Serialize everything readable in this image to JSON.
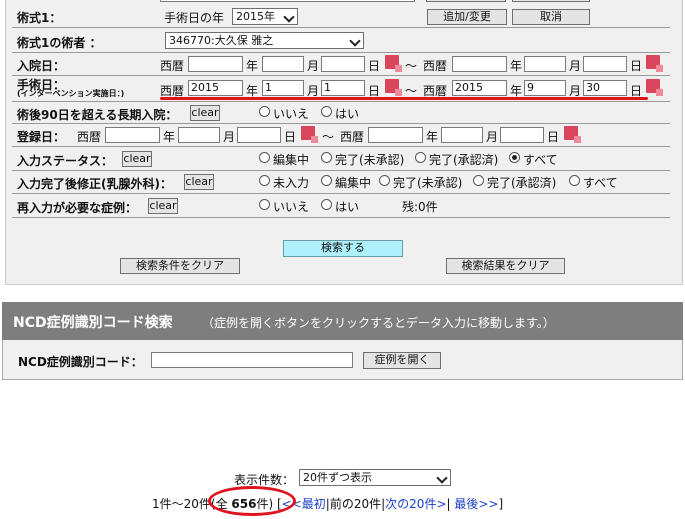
{
  "search_form": {
    "procedure1": {
      "label": "術式1：",
      "year_label": "手術日の年",
      "year_value": "2015年",
      "add_button": "追加/変更",
      "cancel_button": "取消"
    },
    "surgeon": {
      "label": "術式1の術者 ：",
      "value": "346770:大久保 雅之"
    },
    "admission": {
      "label": "入院日：",
      "era": "西暦",
      "year": "年",
      "month": "月",
      "day": "日",
      "tilde": "～",
      "era2": "西暦",
      "year2": "年",
      "month2": "月",
      "day2": "日"
    },
    "surgery_date": {
      "label": "手術日：",
      "sublabel": "(インターベンション実施日：)",
      "era": "西暦",
      "from_year": "2015",
      "year": "年",
      "from_month": "1",
      "month": "月",
      "from_day": "1",
      "day": "日",
      "tilde": "～",
      "era2": "西暦",
      "to_year": "2015",
      "year2": "年",
      "to_month": "9",
      "month2": "月",
      "to_day": "30",
      "day2": "日"
    },
    "long_stay": {
      "label": "術後90日を超える長期入院：",
      "clear": "clear",
      "opt_no": "いいえ",
      "opt_yes": "はい"
    },
    "registration": {
      "label": "登録日：",
      "era": "西暦",
      "year": "年",
      "month": "月",
      "day": "日",
      "tilde": "～",
      "era2": "西暦",
      "year2": "年",
      "month2": "月",
      "day2": "日"
    },
    "input_status": {
      "label": "入力ステータス：",
      "clear": "clear",
      "opt1": "編集中",
      "opt2": "完了(未承認)",
      "opt3": "完了(承認済)",
      "opt4": "すべて"
    },
    "post_edit": {
      "label": "入力完了後修正(乳腺外科)：",
      "clear": "clear",
      "opt1": "未入力",
      "opt2": "編集中",
      "opt3": "完了(未承認)",
      "opt4": "完了(承認済)",
      "opt5": "すべて"
    },
    "reinput": {
      "label": "再入力が必要な症例：",
      "clear": "clear",
      "opt_no": "いいえ",
      "opt_yes": "はい",
      "remaining": "残:0件"
    },
    "search_button": "検索する",
    "clear_conditions_button": "検索条件をクリア",
    "clear_results_button": "検索結果をクリア"
  },
  "ncd": {
    "title": "NCD症例識別コード検索",
    "note": "（症例を開くボタンをクリックするとデータ入力に移動します。）",
    "code_label": "NCD症例識別コード：",
    "open_button": "症例を開く"
  },
  "results": {
    "per_page_label": "表示件数：",
    "per_page_value": "20件ずつ表示",
    "range": "1件～20件",
    "total_open": "(全 ",
    "total_count": "656",
    "total_close": "件)",
    "nav_open": "[",
    "first": "<<最初",
    "sep1": "|",
    "prev": "前の20件",
    "sep2": "|",
    "next": "次の20件>",
    "sep3": "|",
    "last": "最後>>",
    "nav_close": "]"
  },
  "colors": {
    "annotation_red": "#e0141e",
    "calendar_icon": "#d9455a",
    "search_button": "#aef0fb",
    "ncd_header": "#7e7e7e"
  }
}
